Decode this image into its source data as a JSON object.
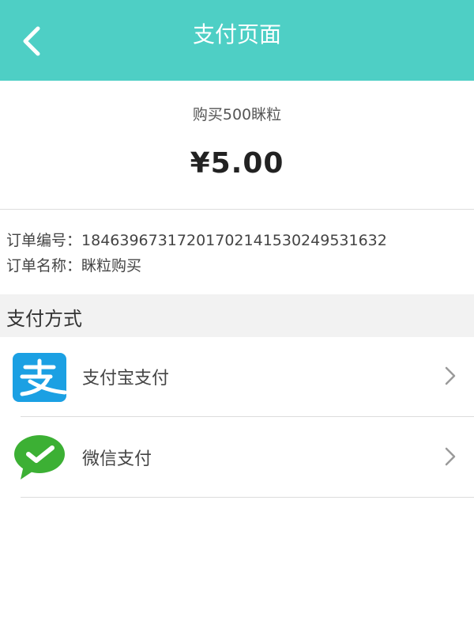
{
  "header": {
    "title": "支付页面",
    "back_icon": "chevron-left-icon",
    "background_color": "#4ecfc5"
  },
  "order": {
    "product_title": "购买500眯粒",
    "price": "¥5.00",
    "number_label": "订单编号：",
    "number_value": "18463967317201702141530249531632",
    "name_label": "订单名称：",
    "name_value": "眯粒购买"
  },
  "payment": {
    "section_title": "支付方式",
    "methods": [
      {
        "label": "支付宝支付",
        "icon": "alipay-icon",
        "color": "#1ba0e3"
      },
      {
        "label": "微信支付",
        "icon": "wechat-pay-icon",
        "color": "#3cb034"
      }
    ],
    "chevron_icon": "chevron-right-icon"
  }
}
